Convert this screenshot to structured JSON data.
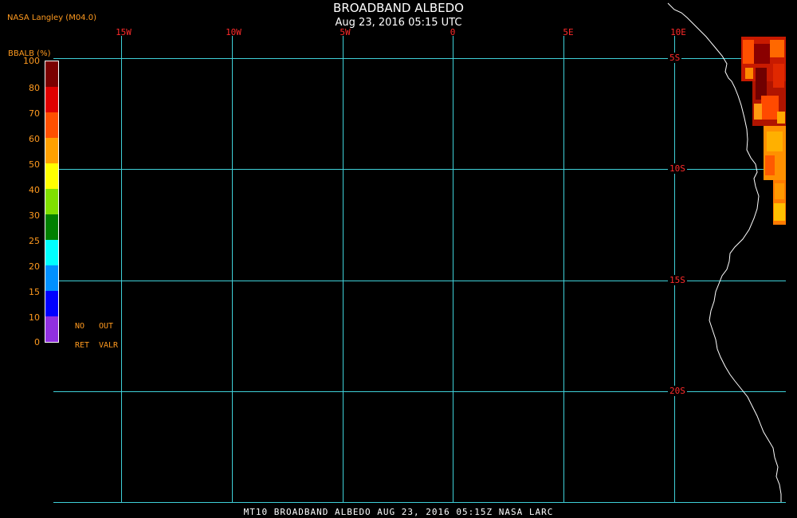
{
  "header": {
    "title": "BROADBAND ALBEDO",
    "datetime": "Aug 23, 2016 05:15 UTC",
    "org": "NASA Langley (M04.0)"
  },
  "map": {
    "lon_labels": [
      "15W",
      "10W",
      "5W",
      "0",
      "5E",
      "10E"
    ],
    "lat_labels": [
      "5S",
      "10S",
      "15S",
      "20S"
    ],
    "grid_color": "#3fd0d8",
    "label_color": "#ff2a2a",
    "coastline_color": "#ffffff",
    "data_region": "bright albedo values along the African coast near 10E–12E, 5S–12S"
  },
  "legend": {
    "title": "BBALB (%)",
    "ticks": [
      "100",
      "80",
      "70",
      "60",
      "50",
      "40",
      "30",
      "25",
      "20",
      "15",
      "10",
      "0"
    ],
    "colors": [
      "#7a0000",
      "#e00000",
      "#ff5000",
      "#ffa000",
      "#ffff00",
      "#80e000",
      "#008000",
      "#00ffff",
      "#0090ff",
      "#0000ff",
      "#0000c0",
      "#9030e0"
    ],
    "no_ret": [
      "NO",
      "RET"
    ],
    "out_valr": [
      "OUT",
      "VALR"
    ]
  },
  "footer": {
    "caption": "MT10  BROADBAND ALBEDO   AUG 23, 2016 05:15Z   NASA LARC"
  }
}
